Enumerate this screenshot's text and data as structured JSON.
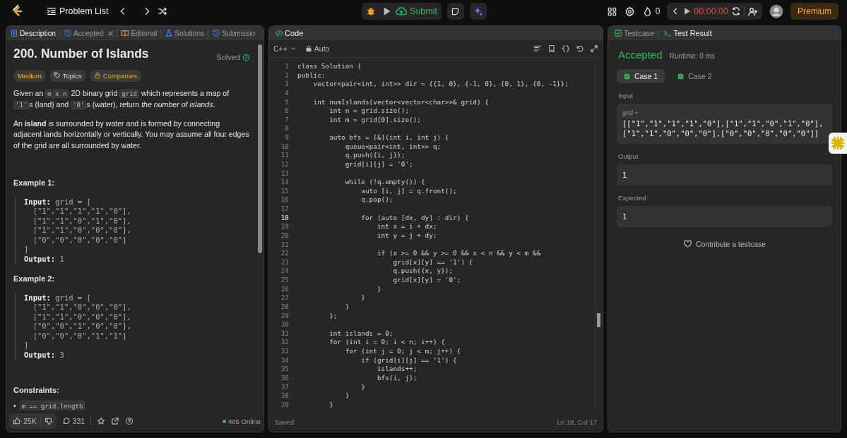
{
  "topbar": {
    "problem_list": "Problem List",
    "submit": "Submit",
    "streak": "0",
    "timer": "00:00:00",
    "premium": "Premium"
  },
  "description_panel": {
    "tabs": [
      {
        "label": "Description",
        "kind": "description",
        "selected": true,
        "closable": false
      },
      {
        "label": "Accepted",
        "kind": "history",
        "selected": false,
        "closable": true
      },
      {
        "label": "Editorial",
        "kind": "book",
        "selected": false,
        "closable": false
      },
      {
        "label": "Solutions",
        "kind": "flask",
        "selected": false,
        "closable": false
      },
      {
        "label": "Submissio",
        "kind": "history",
        "selected": false,
        "closable": false
      }
    ],
    "title": "200. Number of Islands",
    "status": "Solved",
    "tags": [
      {
        "label": "Medium",
        "kind": "difficulty"
      },
      {
        "label": "Topics",
        "kind": "topics"
      },
      {
        "label": "Companies",
        "kind": "companies"
      }
    ],
    "paragraphs": [
      [
        {
          "text": "Given an ",
          "kind": "text"
        },
        {
          "text": "m x n",
          "kind": "code"
        },
        {
          "text": " 2D binary grid ",
          "kind": "text"
        },
        {
          "text": "grid",
          "kind": "code"
        },
        {
          "text": " which represents a map of ",
          "kind": "text"
        },
        {
          "text": "'1'",
          "kind": "code"
        },
        {
          "text": "s (land) and ",
          "kind": "text"
        },
        {
          "text": "'0'",
          "kind": "code"
        },
        {
          "text": "s (water), return ",
          "kind": "text"
        },
        {
          "text": "the number of islands",
          "kind": "italic"
        },
        {
          "text": ".",
          "kind": "text"
        }
      ],
      [
        {
          "text": "An ",
          "kind": "text"
        },
        {
          "text": "island",
          "kind": "bold"
        },
        {
          "text": " is surrounded by water and is formed by connecting adjacent lands horizontally or vertically. You may assume all four edges of the grid are all surrounded by water.",
          "kind": "text"
        }
      ]
    ],
    "examples": [
      {
        "title": "Example 1:",
        "input_label": "Input:",
        "input_lines": [
          "grid = [",
          "  [\"1\",\"1\",\"1\",\"1\",\"0\"],",
          "  [\"1\",\"1\",\"0\",\"1\",\"0\"],",
          "  [\"1\",\"1\",\"0\",\"0\",\"0\"],",
          "  [\"0\",\"0\",\"0\",\"0\",\"0\"]",
          "]"
        ],
        "output_label": "Output:",
        "output": "1"
      },
      {
        "title": "Example 2:",
        "input_label": "Input:",
        "input_lines": [
          "grid = [",
          "  [\"1\",\"1\",\"0\",\"0\",\"0\"],",
          "  [\"1\",\"1\",\"0\",\"0\",\"0\"],",
          "  [\"0\",\"0\",\"1\",\"0\",\"0\"],",
          "  [\"0\",\"0\",\"0\",\"1\",\"1\"]",
          "]"
        ],
        "output_label": "Output:",
        "output": "3"
      }
    ],
    "constraints_title": "Constraints:",
    "constraints": [
      {
        "marker": "•",
        "text": "m == grid.length"
      }
    ],
    "likes": "25K",
    "comments": "331",
    "online": "405 Online"
  },
  "editor_panel": {
    "title": "Code",
    "language": "C++",
    "mode": "Auto",
    "lines": [
      {
        "number": "1",
        "text": "class Solution {",
        "current": false
      },
      {
        "number": "2",
        "text": "public:",
        "current": false
      },
      {
        "number": "3",
        "text": "    vector<pair<int, int>> dir = {{1, 0}, {-1, 0}, {0, 1}, {0, -1}};",
        "current": false
      },
      {
        "number": "4",
        "current": false
      },
      {
        "number": "5",
        "text": "    int numIslands(vector<vector<char>>& grid) {",
        "current": false
      },
      {
        "number": "6",
        "text": "        int n = grid.size();",
        "current": false
      },
      {
        "number": "7",
        "text": "        int m = grid[0].size();",
        "current": false
      },
      {
        "number": "8",
        "current": false
      },
      {
        "number": "9",
        "text": "        auto bfs = [&](int i, int j) {",
        "current": false
      },
      {
        "number": "10",
        "text": "            queue<pair<int, int>> q;",
        "current": false
      },
      {
        "number": "11",
        "text": "            q.push({i, j});",
        "current": false
      },
      {
        "number": "12",
        "text": "            grid[i][j] = '0';",
        "current": false
      },
      {
        "number": "13",
        "current": false
      },
      {
        "number": "14",
        "text": "            while (!q.empty()) {",
        "current": false
      },
      {
        "number": "15",
        "text": "                auto [i, j] = q.front();",
        "current": false
      },
      {
        "number": "16",
        "text": "                q.pop();",
        "current": false
      },
      {
        "number": "17",
        "current": false
      },
      {
        "number": "18",
        "text": "                for (auto [dx, dy] : dir) {",
        "current": true
      },
      {
        "number": "19",
        "text": "                    int x = i + dx;",
        "current": false
      },
      {
        "number": "20",
        "text": "                    int y = j + dy;",
        "current": false
      },
      {
        "number": "21",
        "current": false
      },
      {
        "number": "22",
        "text": "                    if (x >= 0 && y >= 0 && x < n && y < m &&",
        "current": false
      },
      {
        "number": "23",
        "text": "                        grid[x][y] == '1') {",
        "current": false
      },
      {
        "number": "24",
        "text": "                        q.push({x, y});",
        "current": false
      },
      {
        "number": "25",
        "text": "                        grid[x][y] = '0';",
        "current": false
      },
      {
        "number": "26",
        "text": "                    }",
        "current": false
      },
      {
        "number": "27",
        "text": "                }",
        "current": false
      },
      {
        "number": "28",
        "text": "            }",
        "current": false
      },
      {
        "number": "29",
        "text": "        };",
        "current": false
      },
      {
        "number": "30",
        "current": false
      },
      {
        "number": "31",
        "text": "        int islands = 0;",
        "current": false
      },
      {
        "number": "32",
        "text": "        for (int i = 0; i < n; i++) {",
        "current": false
      },
      {
        "number": "33",
        "text": "            for (int j = 0; j < m; j++) {",
        "current": false
      },
      {
        "number": "34",
        "text": "                if (grid[i][j] == '1') {",
        "current": false
      },
      {
        "number": "35",
        "text": "                    islands++;",
        "current": false
      },
      {
        "number": "36",
        "text": "                    bfs(i, j);",
        "current": false
      },
      {
        "number": "37",
        "text": "                }",
        "current": false
      },
      {
        "number": "38",
        "text": "            }",
        "current": false
      },
      {
        "number": "39",
        "text": "        }",
        "current": false
      }
    ],
    "save_status": "Saved",
    "cursor": "Ln 18, Col 17"
  },
  "result_panel": {
    "tabs": [
      {
        "label": "Testcase",
        "kind": "checkbox",
        "selected": false
      },
      {
        "label": "Test Result",
        "kind": "terminal",
        "selected": true
      }
    ],
    "verdict": "Accepted",
    "runtime": "Runtime: 0 ms",
    "cases": [
      {
        "label": "Case 1",
        "selected": true
      },
      {
        "label": "Case 2",
        "selected": false
      }
    ],
    "input_label": "Input",
    "input_name": "grid =",
    "input_value": "[[\"1\",\"1\",\"1\",\"1\",\"0\"],[\"1\",\"1\",\"0\",\"1\",\"0\"],[\"1\",\"1\",\"0\",\"0\",\"0\"],[\"0\",\"0\",\"0\",\"0\",\"0\"]]",
    "output_label": "Output",
    "output": "1",
    "expected_label": "Expected",
    "expected": "1",
    "contribute": "Contribute a testcase"
  }
}
